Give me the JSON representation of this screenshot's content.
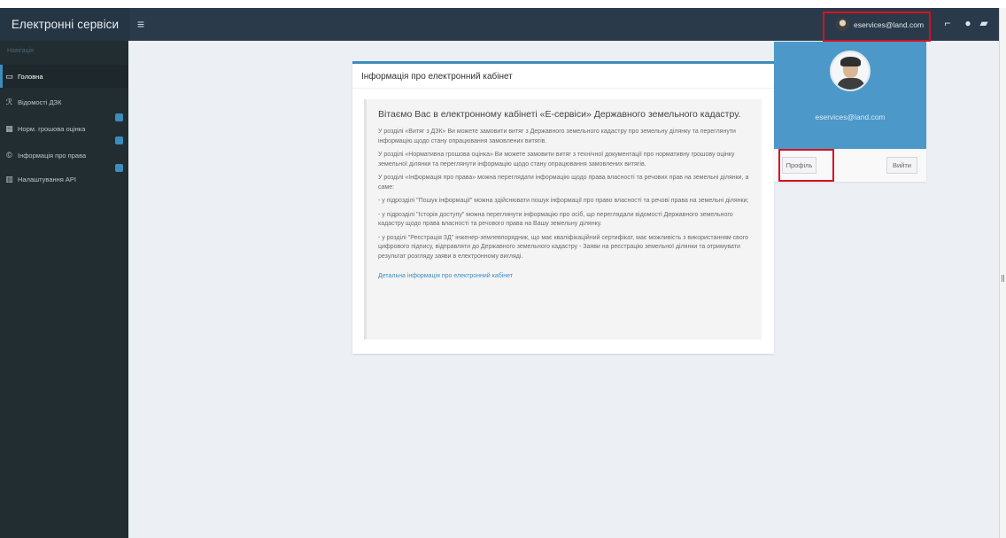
{
  "header": {
    "app_title": "Електронні сервіси",
    "user_email": "eservices@land.com",
    "icons": [
      "menu-icon",
      "user-avatar-icon",
      "notification-icon",
      "help-icon",
      "flag-icon"
    ]
  },
  "sidebar": {
    "heading": "Навігація",
    "items": [
      {
        "label": "Головна",
        "icon": "monitor-icon",
        "active": true
      },
      {
        "label": "Відомості ДЗК",
        "icon": "search-person-icon",
        "badge": ""
      },
      {
        "label": "Норм. грошова оцінка",
        "icon": "calculator-icon",
        "badge": ""
      },
      {
        "label": "Інформація про права",
        "icon": "rights-icon",
        "badge": ""
      },
      {
        "label": "Налаштування API",
        "icon": "grid-icon"
      }
    ]
  },
  "main_card": {
    "title": "Інформація про електронний кабінет",
    "welcome": "Вітаємо Вас в електронному кабінеті «Е-сервіси» Державного земельного кадастру.",
    "paragraphs": [
      "У розділі «Витяг з ДЗК» Ви можете замовити витяг з Державного земельного кадастру про земельну ділянку та переглянути інформацію щодо стану опрацювання замовлених витягів.",
      "У розділі «Нормативна грошова оцінка» Ви можете замовити витяг з технічної документації про нормативну грошову оцінку земельної ділянки та переглянути інформацію щодо стану опрацювання замовлених витягів.",
      "У розділі «Інформація про права» можна переглядати інформацію щодо права власності та речових прав на земельні ділянки, а саме:",
      "- у підрозділі \"Пошук інформації\" можна здійснювати пошук інформації про право власності та речові права на земельні ділянки;",
      "- у підрозділі \"Історія доступу\" можна переглянути інформацію про осіб, що переглядали відомості Державного земельного кадастру щодо права власності та речового права на Вашу земельну ділянку.",
      "- у розділі \"Реєстрація ЗД\" інженер-землевпорядник, що має кваліфікаційний сертифікат, має можливість з використанням свого цифрового підпису, відправляти до Державного земельного кадастру - Заяви на реєстрацію земельної ділянки та отримувати результат розгляду заяви в електронному вигляді."
    ],
    "link": "Детальна інформація про електронний кабінет"
  },
  "profile_widget": {
    "email": "eservices@land.com",
    "profile_button": "Профіль",
    "logout_button": "Вийти"
  },
  "colors": {
    "header_bg": "#2b3a4a",
    "sidebar_bg": "#222d32",
    "accent": "#3c8dbc",
    "profile_bg": "#4b98c9",
    "highlight": "#d8111d"
  }
}
